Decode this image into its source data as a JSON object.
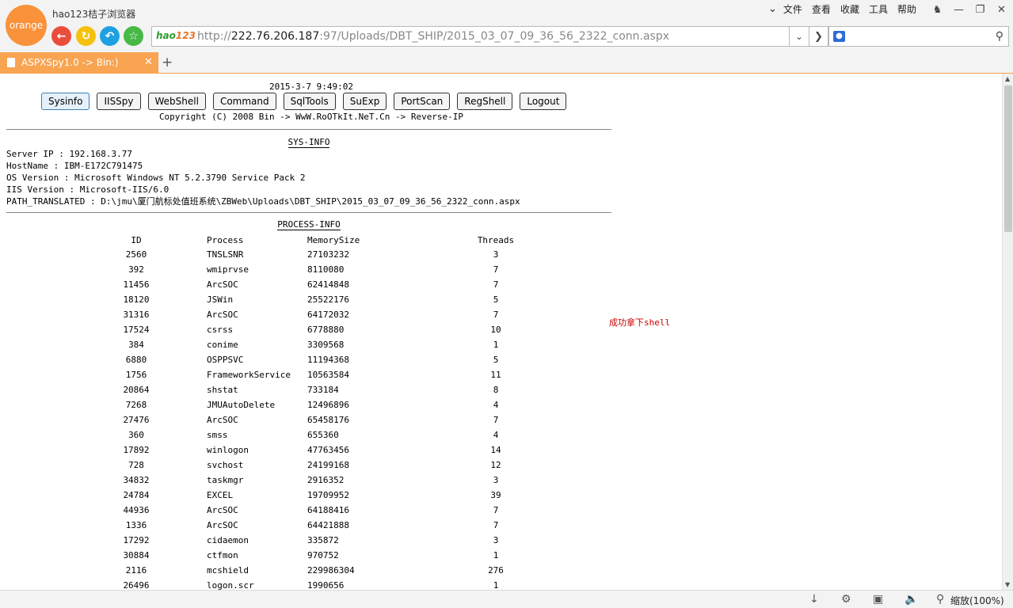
{
  "browser": {
    "logo_text": "orange",
    "title": "hao123桔子浏览器",
    "menu": [
      "文件",
      "查看",
      "收藏",
      "工具",
      "帮助"
    ],
    "site_logo_a": "hao",
    "site_logo_b": "123",
    "url_scheme": "http://",
    "url_host": "222.76.206.187",
    "url_rest": ":97/Uploads/DBT_SHIP/2015_03_07_09_36_56_2322_conn.aspx",
    "tab_label": "ASPXSpy1.0 -> Bin:)",
    "zoom": "缩放(100%)"
  },
  "page": {
    "datetime": "2015-3-7 9:49:02",
    "buttons": [
      "Sysinfo",
      "IISSpy",
      "WebShell",
      "Command",
      "SqlTools",
      "SuExp",
      "PortScan",
      "RegShell",
      "Logout"
    ],
    "copyright": "Copyright (C) 2008 Bin -> WwW.RoOTkIt.NeT.Cn -> Reverse-IP",
    "sysinfo_title": "SYS-INFO",
    "sysinfo": [
      "Server IP : 192.168.3.77",
      "HostName : IBM-E172C791475",
      "OS Version : Microsoft Windows NT 5.2.3790 Service Pack 2",
      "IIS Version : Microsoft-IIS/6.0",
      "PATH_TRANSLATED : D:\\jmu\\厦门航标处值班系统\\ZBWeb\\Uploads\\DBT_SHIP\\2015_03_07_09_36_56_2322_conn.aspx"
    ],
    "process_title": "PROCESS-INFO",
    "process_headers": [
      "ID",
      "Process",
      "MemorySize",
      "Threads"
    ],
    "processes": [
      [
        "2560",
        "TNSLSNR",
        "27103232",
        "3"
      ],
      [
        "392",
        "wmiprvse",
        "8110080",
        "7"
      ],
      [
        "11456",
        "ArcSOC",
        "62414848",
        "7"
      ],
      [
        "18120",
        "JSWin",
        "25522176",
        "5"
      ],
      [
        "31316",
        "ArcSOC",
        "64172032",
        "7"
      ],
      [
        "17524",
        "csrss",
        "6778880",
        "10"
      ],
      [
        "384",
        "conime",
        "3309568",
        "1"
      ],
      [
        "6880",
        "OSPPSVC",
        "11194368",
        "5"
      ],
      [
        "1756",
        "FrameworkService",
        "10563584",
        "11"
      ],
      [
        "20864",
        "shstat",
        "733184",
        "8"
      ],
      [
        "7268",
        "JMUAutoDelete",
        "12496896",
        "4"
      ],
      [
        "27476",
        "ArcSOC",
        "65458176",
        "7"
      ],
      [
        "360",
        "smss",
        "655360",
        "4"
      ],
      [
        "17892",
        "winlogon",
        "47763456",
        "14"
      ],
      [
        "728",
        "svchost",
        "24199168",
        "12"
      ],
      [
        "34832",
        "taskmgr",
        "2916352",
        "3"
      ],
      [
        "24784",
        "EXCEL",
        "19709952",
        "39"
      ],
      [
        "44936",
        "ArcSOC",
        "64188416",
        "7"
      ],
      [
        "1336",
        "ArcSOC",
        "64421888",
        "7"
      ],
      [
        "17292",
        "cidaemon",
        "335872",
        "3"
      ],
      [
        "30884",
        "ctfmon",
        "970752",
        "1"
      ],
      [
        "2116",
        "mcshield",
        "229986304",
        "276"
      ],
      [
        "26496",
        "logon.scr",
        "1990656",
        "1"
      ]
    ],
    "note": "成功拿下shell"
  }
}
